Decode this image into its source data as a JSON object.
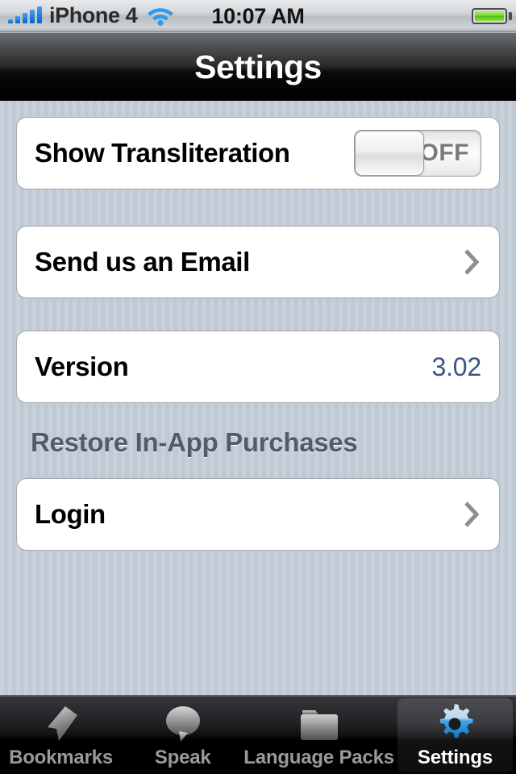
{
  "status_bar": {
    "carrier": "iPhone 4",
    "time": "10:07 AM",
    "signal_icon": "signal-bars-icon",
    "wifi_icon": "wifi-icon",
    "battery_icon": "battery-full-icon",
    "signal_color": "#1a76d2",
    "wifi_color": "#2e9bef",
    "battery_color": "#79d536"
  },
  "nav": {
    "title": "Settings"
  },
  "rows": {
    "transliteration": {
      "label": "Show Transliteration",
      "switch_state": "OFF"
    },
    "email": {
      "label": "Send us an Email",
      "chevron": "chevron-right-icon"
    },
    "version": {
      "label": "Version",
      "value": "3.02",
      "value_color": "#3a5584"
    },
    "restore_header": "Restore In-App Purchases",
    "login": {
      "label": "Login",
      "chevron": "chevron-right-icon"
    }
  },
  "tab_bar": {
    "tabs": [
      {
        "label": "Bookmarks",
        "icon": "bookmark-icon",
        "active": false
      },
      {
        "label": "Speak",
        "icon": "speech-bubble-icon",
        "active": false
      },
      {
        "label": "Language Packs",
        "icon": "folder-icon",
        "active": false
      },
      {
        "label": "Settings",
        "icon": "gear-icon",
        "active": true
      }
    ],
    "active_icon_color": "#2b9ae8"
  }
}
